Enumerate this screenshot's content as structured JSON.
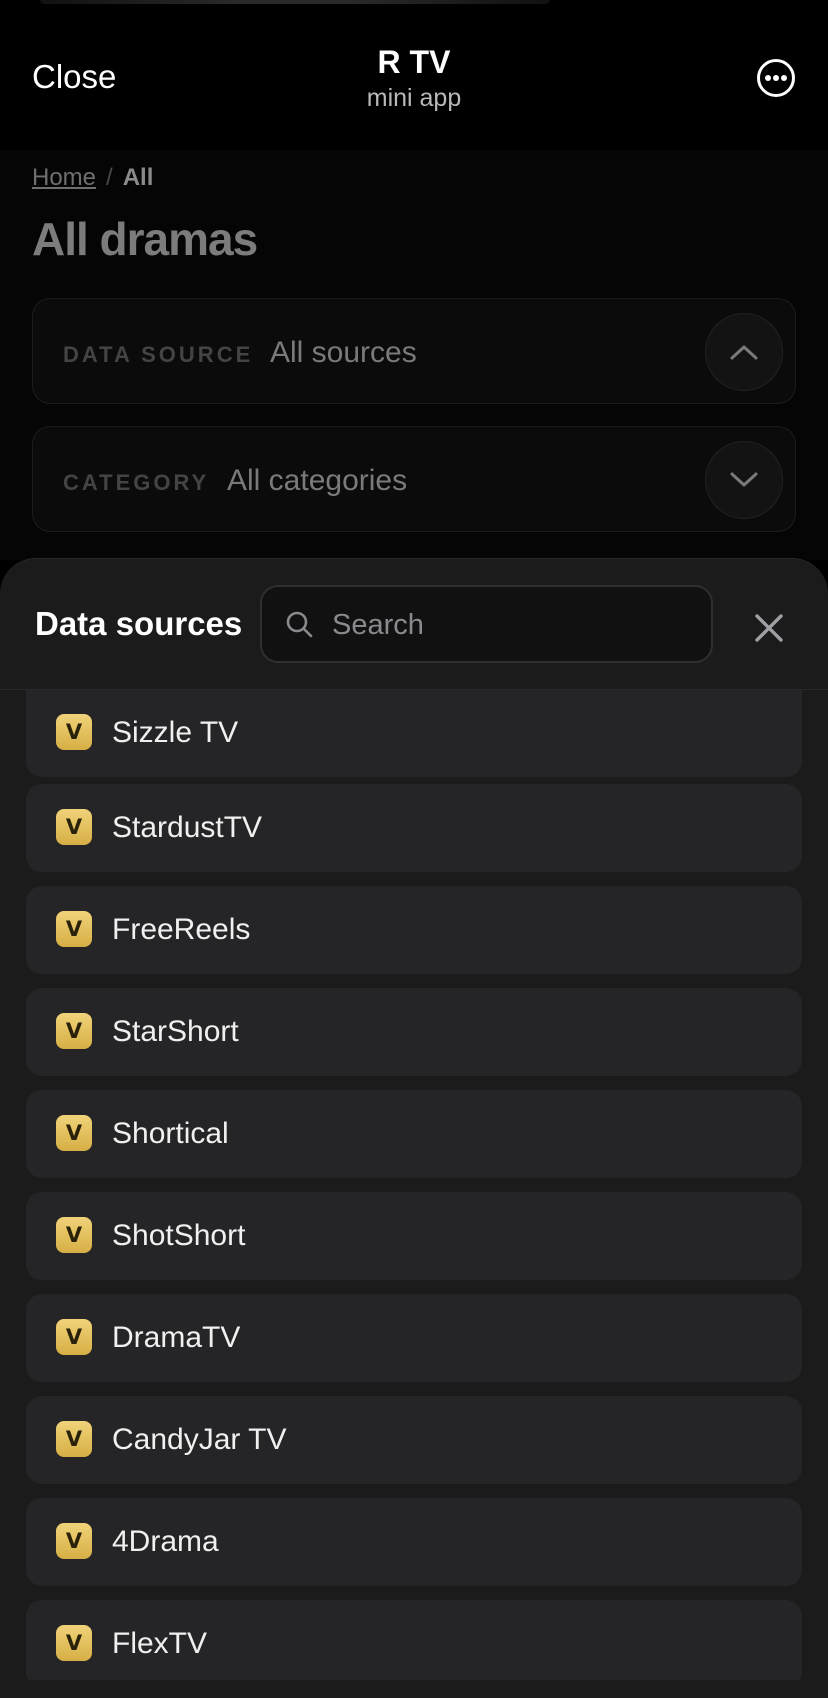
{
  "header": {
    "close_label": "Close",
    "title": "R TV",
    "subtitle": "mini app",
    "more_icon": "more-horizontal-circle-icon"
  },
  "page": {
    "breadcrumb": {
      "home": "Home",
      "separator": "/",
      "current": "All"
    },
    "title": "All dramas",
    "filters": [
      {
        "label": "DATA SOURCE",
        "value": "All sources",
        "state": "expanded",
        "icon": "chevron-up-icon"
      },
      {
        "label": "CATEGORY",
        "value": "All categories",
        "state": "collapsed",
        "icon": "chevron-down-icon"
      }
    ]
  },
  "sheet": {
    "title": "Data sources",
    "search_placeholder": "Search",
    "search_value": "",
    "close_icon": "close-icon",
    "badge_text": "V",
    "items": [
      {
        "label": "Sizzle TV"
      },
      {
        "label": "StardustTV"
      },
      {
        "label": "FreeReels"
      },
      {
        "label": "StarShort"
      },
      {
        "label": "Shortical"
      },
      {
        "label": "ShotShort"
      },
      {
        "label": "DramaTV"
      },
      {
        "label": "CandyJar TV"
      },
      {
        "label": "4Drama"
      },
      {
        "label": "FlexTV"
      }
    ]
  },
  "colors": {
    "background": "#000000",
    "sheet": "#1b1b1c",
    "list_item": "#252527",
    "badge_gold": "#e4c25f"
  }
}
